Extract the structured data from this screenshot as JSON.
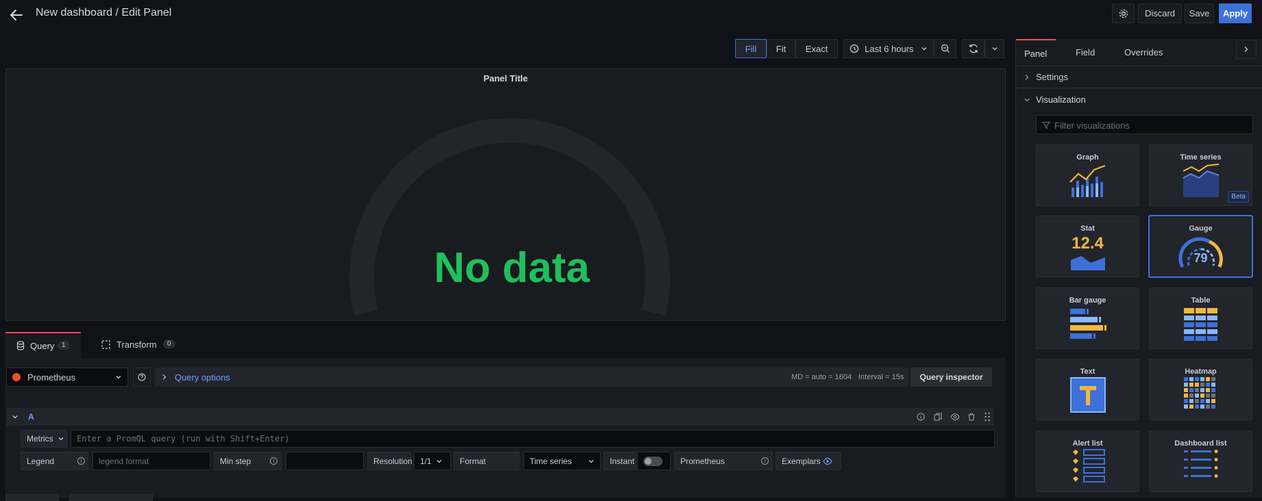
{
  "header": {
    "title": "New dashboard / Edit Panel",
    "discard_label": "Discard",
    "save_label": "Save",
    "apply_label": "Apply"
  },
  "toolbar": {
    "fill_label": "Fill",
    "fit_label": "Fit",
    "exact_label": "Exact",
    "time_range_label": "Last 6 hours"
  },
  "panel": {
    "title": "Panel Title",
    "no_data": "No data"
  },
  "query_tabs": {
    "query_label": "Query",
    "query_count": "1",
    "transform_label": "Transform",
    "transform_count": "0"
  },
  "datasource": {
    "name": "Prometheus",
    "query_options_label": "Query options",
    "md_info": "MD = auto = 1604",
    "interval_info": "Interval = 15s",
    "inspector_label": "Query inspector"
  },
  "query_row": {
    "ref_id": "A",
    "metrics_label": "Metrics",
    "promql_placeholder": "Enter a PromQL query (run with Shift+Enter)",
    "legend_label": "Legend",
    "legend_placeholder": "legend format",
    "min_step_label": "Min step",
    "resolution_label": "Resolution",
    "resolution_value": "1/1",
    "format_label": "Format",
    "format_value": "Time series",
    "instant_label": "Instant",
    "prometheus_label": "Prometheus",
    "exemplars_label": "Exemplars"
  },
  "options_pane": {
    "tabs": [
      "Panel",
      "Field",
      "Overrides"
    ],
    "settings_label": "Settings",
    "visualization_label": "Visualization",
    "filter_placeholder": "Filter visualizations",
    "viz": [
      {
        "name": "Graph"
      },
      {
        "name": "Time series",
        "badge": "Beta"
      },
      {
        "name": "Stat",
        "sample": "12.4"
      },
      {
        "name": "Gauge",
        "sample": "79"
      },
      {
        "name": "Bar gauge"
      },
      {
        "name": "Table"
      },
      {
        "name": "Text"
      },
      {
        "name": "Heatmap"
      },
      {
        "name": "Alert list"
      },
      {
        "name": "Dashboard list"
      }
    ]
  },
  "colors": {
    "background": "#111217",
    "panel": "#181b1f",
    "primary": "#3d71d9",
    "no_data_green": "#1fbf5c",
    "accent_orange": "#f2495c"
  }
}
